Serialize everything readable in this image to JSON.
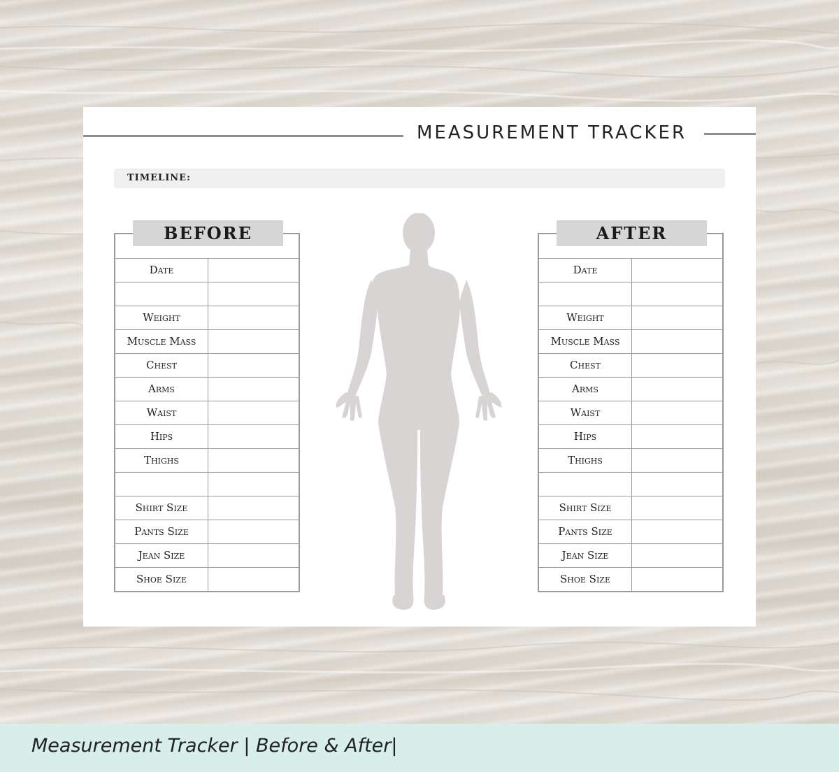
{
  "document": {
    "title": "MEASUREMENT TRACKER",
    "timeline_label": "TIMELINE:",
    "before": {
      "header": "BEFORE",
      "rows": [
        "Date",
        "",
        "Weight",
        "Muscle Mass",
        "Chest",
        "Arms",
        "Waist",
        "Hips",
        "Thighs",
        "",
        "Shirt Size",
        "Pants Size",
        "Jean Size",
        "Shoe Size"
      ]
    },
    "after": {
      "header": "AFTER",
      "rows": [
        "Date",
        "",
        "Weight",
        "Muscle Mass",
        "Chest",
        "Arms",
        "Waist",
        "Hips",
        "Thighs",
        "",
        "Shirt Size",
        "Pants Size",
        "Jean Size",
        "Shoe Size"
      ]
    }
  },
  "caption": "Measurement Tracker | Before & After|",
  "colors": {
    "silhouette": "#d9d4d4",
    "header_fill": "#d6d6d6",
    "caption_band": "#d8eeea"
  }
}
